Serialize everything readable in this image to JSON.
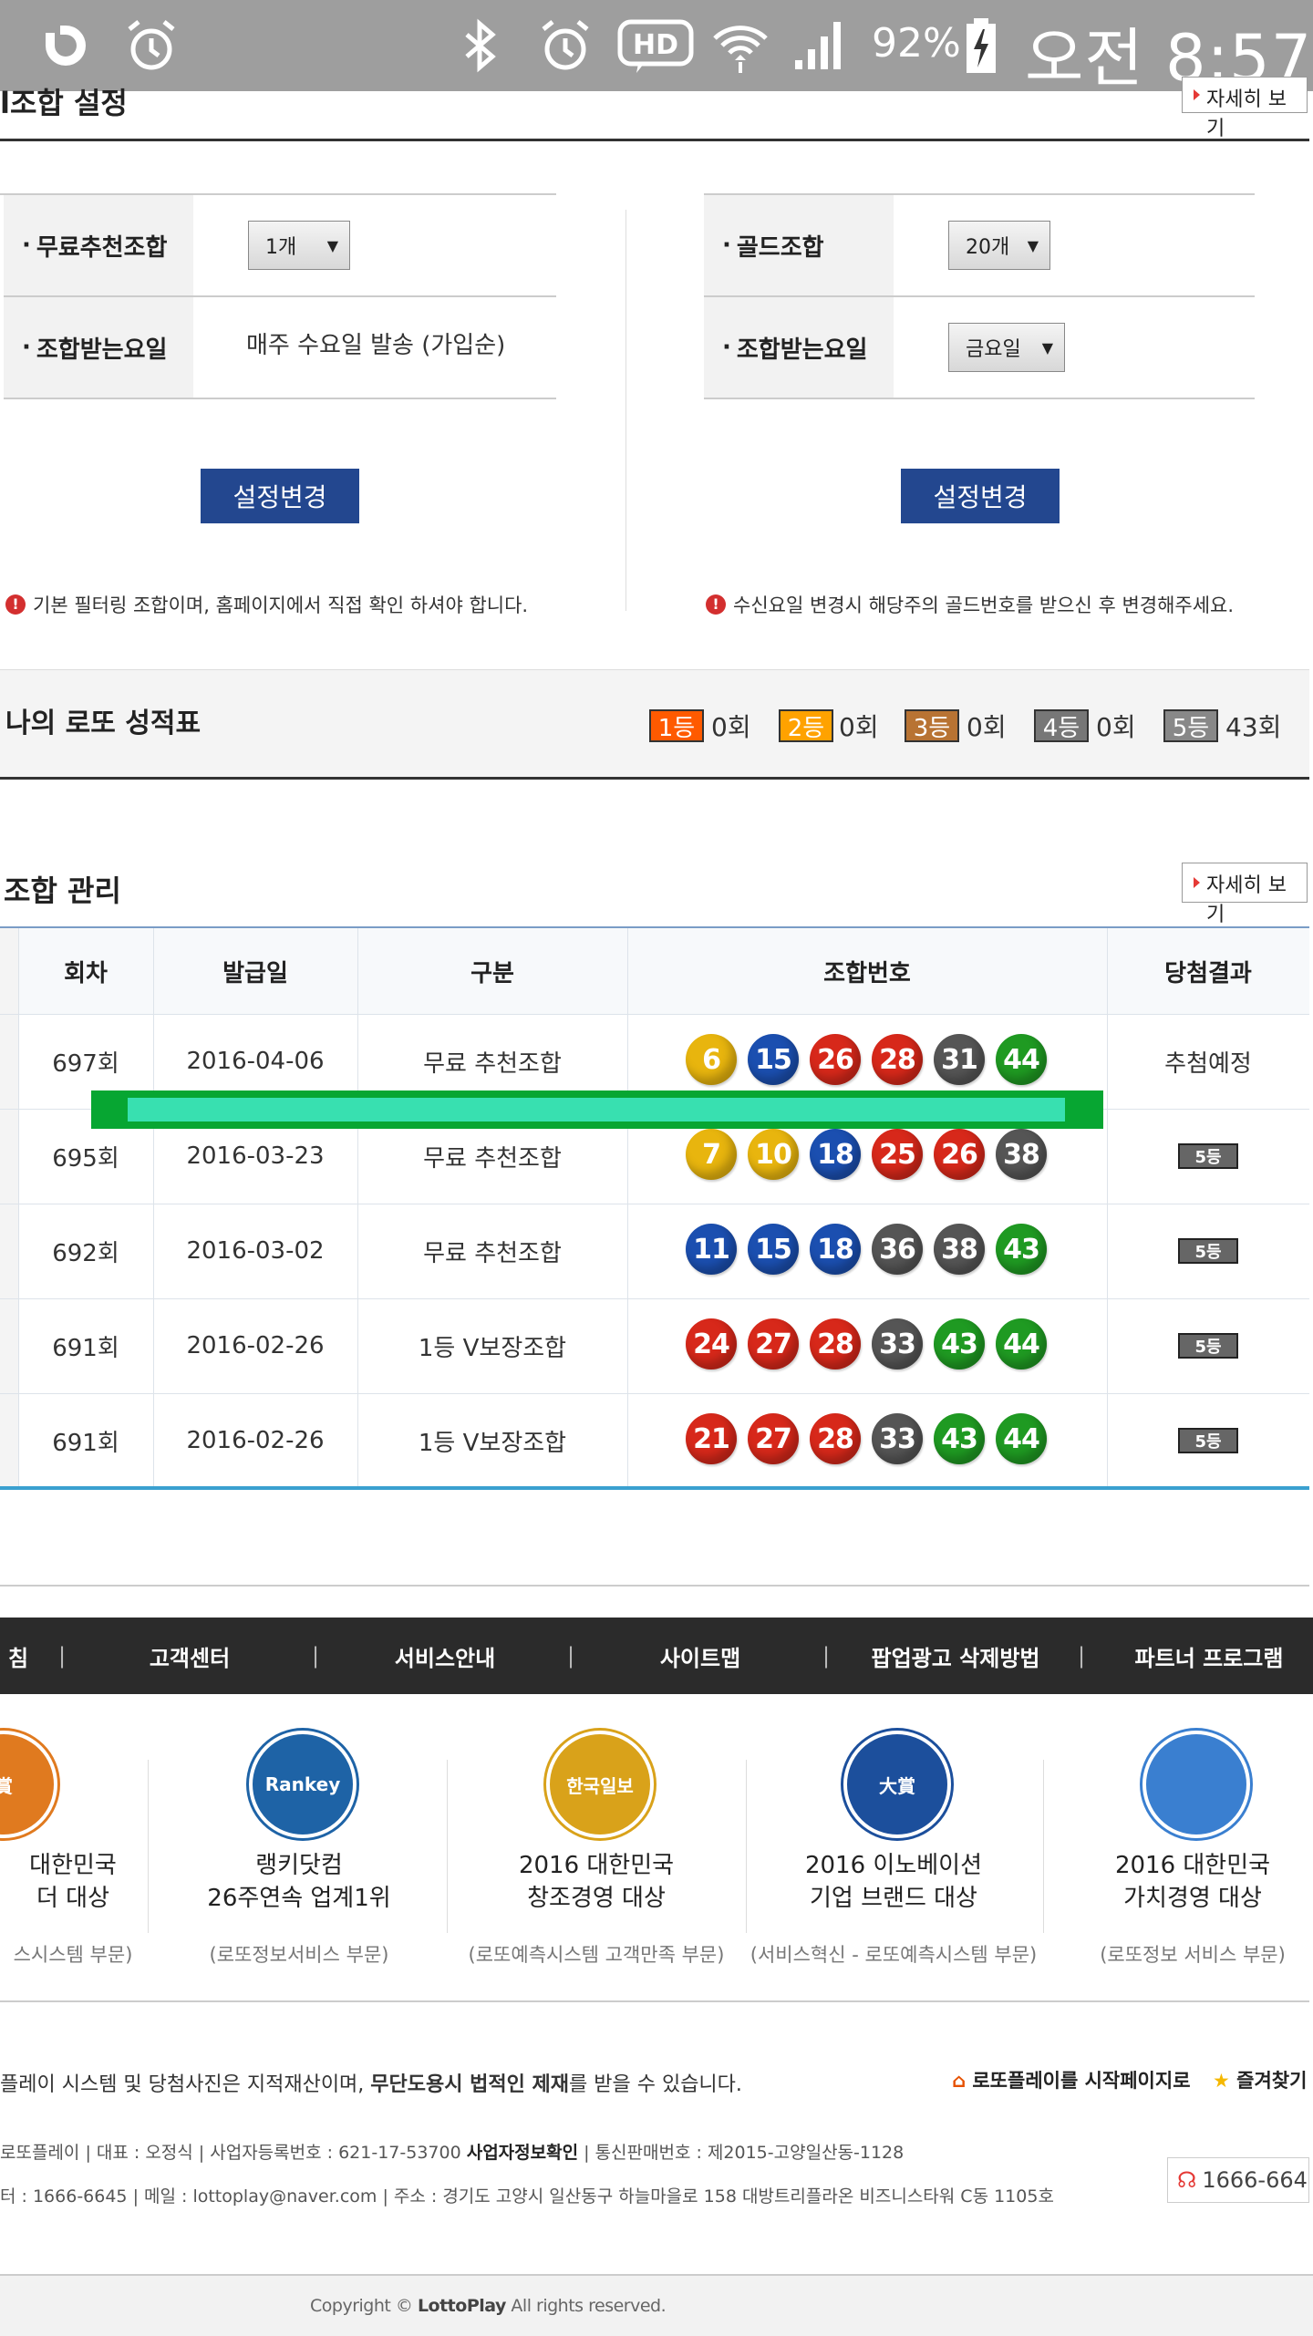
{
  "status_bar": {
    "battery": "92%",
    "clock": "오전 8:57"
  },
  "combo_settings": {
    "title": "l조합 설정",
    "more_label": "자세히 보기",
    "left": {
      "row1_label": "무료추천조합",
      "row1_value": "1개",
      "row2_label": "조합받는요일",
      "row2_value": "매주 수요일 발송 (가입순)",
      "button": "설정변경",
      "note": "기본 필터링 조합이며, 홈페이지에서 직접 확인 하셔야 합니다."
    },
    "right": {
      "row1_label": "골드조합",
      "row1_value": "20개",
      "row2_label": "조합받는요일",
      "row2_value": "금요일",
      "button": "설정변경",
      "note": "수신요일 변경시 해당주의 골드번호를 받으신 후 변경해주세요."
    }
  },
  "scorecard": {
    "title": "나의 로또 성적표",
    "ranks": [
      {
        "label": "1등",
        "count": "0회",
        "color": "#ff5a00"
      },
      {
        "label": "2등",
        "count": "0회",
        "color": "#ffa200"
      },
      {
        "label": "3등",
        "count": "0회",
        "color": "#b87333"
      },
      {
        "label": "4등",
        "count": "0회",
        "color": "#777777"
      },
      {
        "label": "5등",
        "count": "43회",
        "color": "#888888"
      }
    ]
  },
  "combo_manage": {
    "title": "조합 관리",
    "more_label": "자세히 보기",
    "headers": [
      "회차",
      "발급일",
      "구분",
      "조합번호",
      "당첨결과"
    ],
    "rows": [
      {
        "round": "697회",
        "date": "2016-04-06",
        "type": "무료 추천조합",
        "numbers": [
          6,
          15,
          26,
          28,
          31,
          44
        ],
        "result": "추첨예정"
      },
      {
        "round": "695회",
        "date": "2016-03-23",
        "type": "무료 추천조합",
        "numbers": [
          7,
          10,
          18,
          25,
          26,
          38
        ],
        "result": "5등"
      },
      {
        "round": "692회",
        "date": "2016-03-02",
        "type": "무료 추천조합",
        "numbers": [
          11,
          15,
          18,
          36,
          38,
          43
        ],
        "result": "5등"
      },
      {
        "round": "691회",
        "date": "2016-02-26",
        "type": "1등 V보장조합",
        "numbers": [
          24,
          27,
          28,
          33,
          43,
          44
        ],
        "result": "5등"
      },
      {
        "round": "691회",
        "date": "2016-02-26",
        "type": "1등 V보장조합",
        "numbers": [
          21,
          27,
          28,
          33,
          43,
          44
        ],
        "result": "5등"
      }
    ],
    "ball_colors": {
      "yellow": "#e8b50e",
      "blue": "#1b4fb0",
      "red": "#d7281a",
      "gray": "#555555",
      "green": "#1f9a22"
    }
  },
  "footer_nav": [
    "침",
    "고객센터",
    "서비스안내",
    "사이트맵",
    "팝업광고 삭제방법",
    "파트너 프로그램"
  ],
  "awards": [
    {
      "title1": "대한민국",
      "title2": "더 대상",
      "sub": "스시스템 부문)",
      "logo_text": "賞"
    },
    {
      "title1": "랭키닷컴",
      "title2": "26주연속 업계1위",
      "sub": "(로또정보서비스 부문)",
      "logo_text": "Rankey"
    },
    {
      "title1": "2016 대한민국",
      "title2": "창조경영 대상",
      "sub": "(로또예측시스템 고객만족 부문)",
      "logo_text": "한국일보"
    },
    {
      "title1": "2016 이노베이션",
      "title2": "기업 브랜드 대상",
      "sub": "(서비스혁신 - 로또예측시스템 부문)",
      "logo_text": "大賞"
    },
    {
      "title1": "2016 대한민국",
      "title2": "가치경영 대상",
      "sub": "(로또정보 서비스 부문)",
      "logo_text": ""
    }
  ],
  "footer_info": {
    "copyright_notice_pre": "플레이 시스템 및 당첨사진은 지적재산이며, ",
    "copyright_notice_bold": "무단도용시 법적인 제재",
    "copyright_notice_post": "를 받을 수 있습니다.",
    "homepage_link": "로또플레이를 시작페이지로",
    "bookmark_link": "즐겨찾기",
    "company_line_pre": "로또플레이 | 대표 : 오정식 | 사업자등록번호 : 621-17-53700 ",
    "company_line_bold": "사업자정보확인",
    "company_line_post": " | 통신판매번호 : 제2015-고양일산동-1128",
    "contact_line": "터 : 1666-6645 | 메일 : lottoplay@naver.com | 주소 : 경기도 고양시 일산동구 하늘마을로 158 대방트리플라온 비즈니스타워 C동 1105호",
    "phone_button": "1666-664",
    "copyright_pre": "Copyright ",
    "copyright_brand": "LottoPlay",
    "copyright_post": " All rights reserved."
  }
}
